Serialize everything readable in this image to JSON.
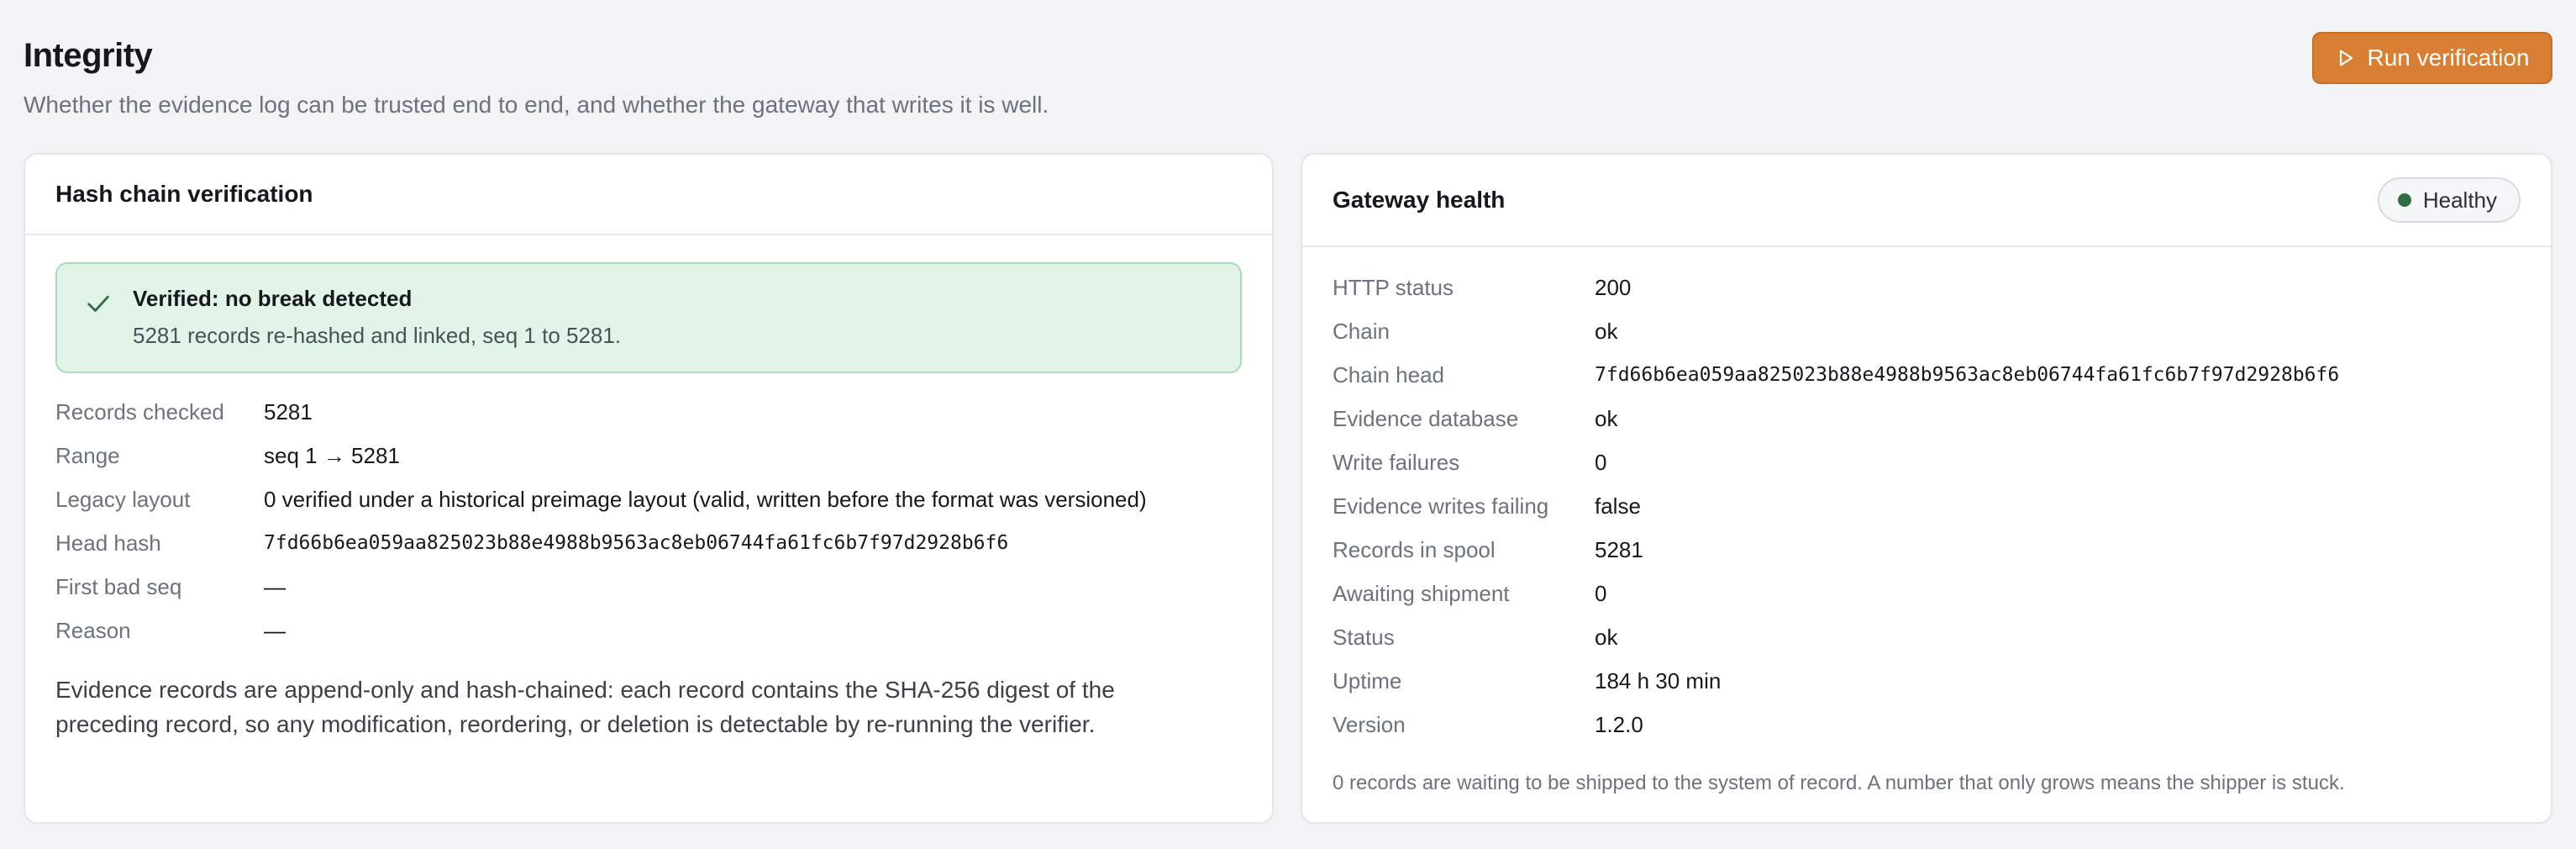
{
  "header": {
    "title": "Integrity",
    "subtitle": "Whether the evidence log can be trusted end to end, and whether the gateway that writes it is well.",
    "run_button_label": "Run verification"
  },
  "hash_chain": {
    "title": "Hash chain verification",
    "alert": {
      "title": "Verified: no break detected",
      "text": "5281 records re-hashed and linked, seq 1 to 5281."
    },
    "rows": [
      {
        "label": "Records checked",
        "value": "5281"
      },
      {
        "label": "Range",
        "value": "seq 1 → 5281"
      },
      {
        "label": "Legacy layout",
        "value": "0 verified under a historical preimage layout (valid, written before the format was versioned)"
      },
      {
        "label": "Head hash",
        "value": "7fd66b6ea059aa825023b88e4988b9563ac8eb06744fa61fc6b7f97d2928b6f6"
      },
      {
        "label": "First bad seq",
        "value": "—"
      },
      {
        "label": "Reason",
        "value": "—"
      }
    ],
    "note": "Evidence records are append-only and hash-chained: each record contains the SHA-256 digest of the preceding record, so any modification, reordering, or deletion is detectable by re-running the verifier."
  },
  "gateway": {
    "title": "Gateway health",
    "badge": "Healthy",
    "badge_color": "#2f6e45",
    "rows": [
      {
        "label": "HTTP status",
        "value": "200"
      },
      {
        "label": "Chain",
        "value": "ok"
      },
      {
        "label": "Chain head",
        "value": "7fd66b6ea059aa825023b88e4988b9563ac8eb06744fa61fc6b7f97d2928b6f6"
      },
      {
        "label": "Evidence database",
        "value": "ok"
      },
      {
        "label": "Write failures",
        "value": "0"
      },
      {
        "label": "Evidence writes failing",
        "value": "false"
      },
      {
        "label": "Records in spool",
        "value": "5281"
      },
      {
        "label": "Awaiting shipment",
        "value": "0"
      },
      {
        "label": "Status",
        "value": "ok"
      },
      {
        "label": "Uptime",
        "value": "184 h 30 min"
      },
      {
        "label": "Version",
        "value": "1.2.0"
      }
    ],
    "note": "0 records are waiting to be shipped to the system of record. A number that only grows means the shipper is stuck."
  },
  "colors": {
    "accent": "#d97f33",
    "success_bg": "#e2f4e8",
    "success_border": "#a9dbb9"
  },
  "icons": {
    "run_button": "play-icon",
    "alert": "check-icon",
    "badge": "status-dot-icon"
  }
}
